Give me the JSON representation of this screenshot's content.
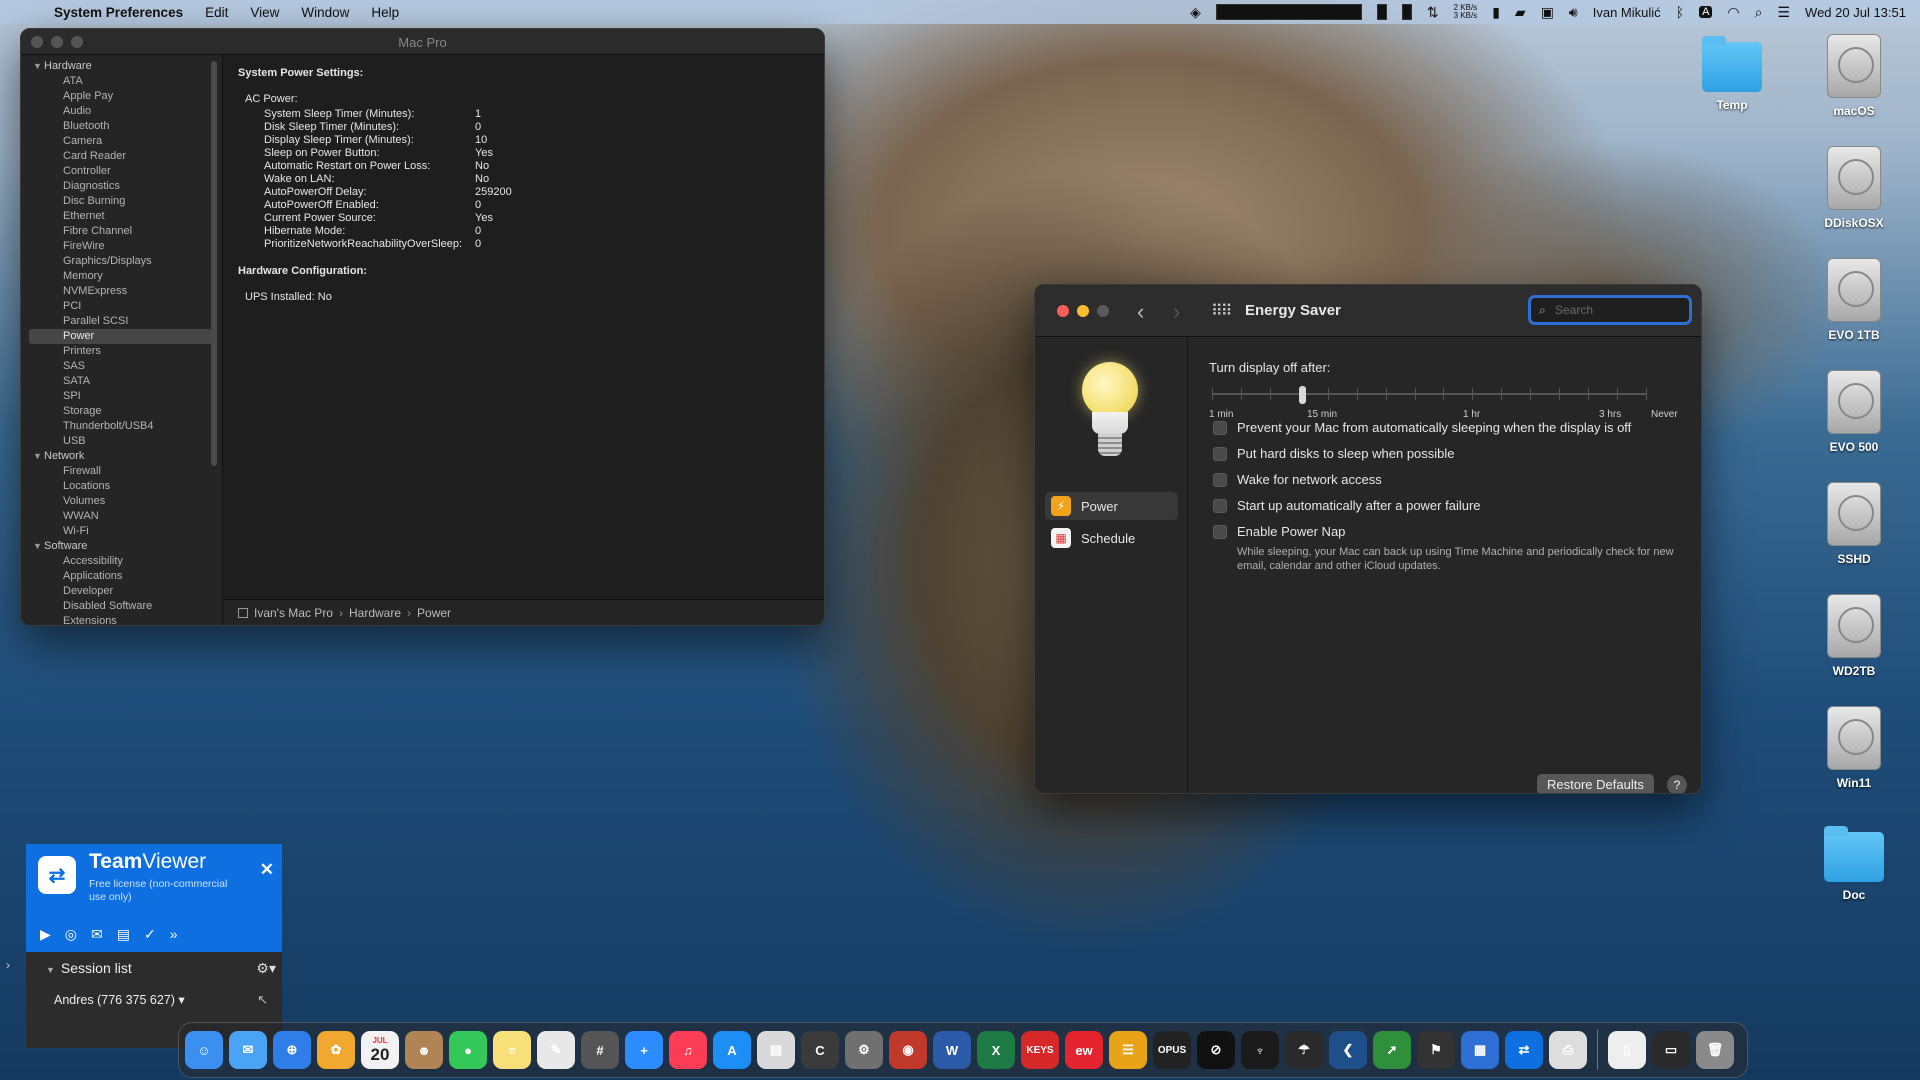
{
  "menubar": {
    "app_name": "System Preferences",
    "menus": [
      "Edit",
      "View",
      "Window",
      "Help"
    ],
    "net_up": "2 KB/s",
    "net_down": "3 KB/s",
    "user": "Ivan Mikulić",
    "datetime": "Wed 20 Jul  13:51"
  },
  "sysinfo": {
    "title": "Mac Pro",
    "sidebar": [
      {
        "type": "group",
        "label": "Hardware"
      },
      {
        "type": "item",
        "label": "ATA"
      },
      {
        "type": "item",
        "label": "Apple Pay"
      },
      {
        "type": "item",
        "label": "Audio"
      },
      {
        "type": "item",
        "label": "Bluetooth"
      },
      {
        "type": "item",
        "label": "Camera"
      },
      {
        "type": "item",
        "label": "Card Reader"
      },
      {
        "type": "item",
        "label": "Controller"
      },
      {
        "type": "item",
        "label": "Diagnostics"
      },
      {
        "type": "item",
        "label": "Disc Burning"
      },
      {
        "type": "item",
        "label": "Ethernet"
      },
      {
        "type": "item",
        "label": "Fibre Channel"
      },
      {
        "type": "item",
        "label": "FireWire"
      },
      {
        "type": "item",
        "label": "Graphics/Displays"
      },
      {
        "type": "item",
        "label": "Memory"
      },
      {
        "type": "item",
        "label": "NVMExpress"
      },
      {
        "type": "item",
        "label": "PCI"
      },
      {
        "type": "item",
        "label": "Parallel SCSI"
      },
      {
        "type": "item",
        "label": "Power",
        "selected": true
      },
      {
        "type": "item",
        "label": "Printers"
      },
      {
        "type": "item",
        "label": "SAS"
      },
      {
        "type": "item",
        "label": "SATA"
      },
      {
        "type": "item",
        "label": "SPI"
      },
      {
        "type": "item",
        "label": "Storage"
      },
      {
        "type": "item",
        "label": "Thunderbolt/USB4"
      },
      {
        "type": "item",
        "label": "USB"
      },
      {
        "type": "group",
        "label": "Network"
      },
      {
        "type": "item",
        "label": "Firewall"
      },
      {
        "type": "item",
        "label": "Locations"
      },
      {
        "type": "item",
        "label": "Volumes"
      },
      {
        "type": "item",
        "label": "WWAN"
      },
      {
        "type": "item",
        "label": "Wi-Fi"
      },
      {
        "type": "group",
        "label": "Software"
      },
      {
        "type": "item",
        "label": "Accessibility"
      },
      {
        "type": "item",
        "label": "Applications"
      },
      {
        "type": "item",
        "label": "Developer"
      },
      {
        "type": "item",
        "label": "Disabled Software"
      },
      {
        "type": "item",
        "label": "Extensions"
      }
    ],
    "content": {
      "heading": "System Power Settings:",
      "subheading": "AC Power:",
      "rows": [
        {
          "k": "System Sleep Timer (Minutes):",
          "v": "1"
        },
        {
          "k": "Disk Sleep Timer (Minutes):",
          "v": "0"
        },
        {
          "k": "Display Sleep Timer (Minutes):",
          "v": "10"
        },
        {
          "k": "Sleep on Power Button:",
          "v": "Yes"
        },
        {
          "k": "Automatic Restart on Power Loss:",
          "v": "No"
        },
        {
          "k": "Wake on LAN:",
          "v": "No"
        },
        {
          "k": "AutoPowerOff Delay:",
          "v": "259200"
        },
        {
          "k": "AutoPowerOff Enabled:",
          "v": "0"
        },
        {
          "k": "Current Power Source:",
          "v": "Yes"
        },
        {
          "k": "Hibernate Mode:",
          "v": "0"
        },
        {
          "k": "PrioritizeNetworkReachabilityOverSleep:",
          "v": "0"
        }
      ],
      "heading2": "Hardware Configuration:",
      "ups": "UPS Installed:  No"
    },
    "path": [
      "Ivan's Mac Pro",
      "Hardware",
      "Power"
    ]
  },
  "energy": {
    "title": "Energy Saver",
    "search_placeholder": "Search",
    "sidebar": [
      {
        "label": "Power",
        "icon": "lightning-icon",
        "selected": true
      },
      {
        "label": "Schedule",
        "icon": "calendar-icon",
        "selected": false
      }
    ],
    "slider_label": "Turn display off after:",
    "slider_value_fraction": 0.2,
    "slider_labels": [
      "1 min",
      "15 min",
      "1 hr",
      "3 hrs",
      "Never"
    ],
    "options": [
      {
        "label": "Prevent your Mac from automatically sleeping when the display is off",
        "checked": false
      },
      {
        "label": "Put hard disks to sleep when possible",
        "checked": false
      },
      {
        "label": "Wake for network access",
        "checked": false
      },
      {
        "label": "Start up automatically after a power failure",
        "checked": false
      },
      {
        "label": "Enable Power Nap",
        "checked": false
      }
    ],
    "power_nap_note": "While sleeping, your Mac can back up using Time Machine and periodically check for new email, calendar and other iCloud updates.",
    "restore_label": "Restore Defaults",
    "help_label": "?"
  },
  "desktop_icons": [
    {
      "label": "Temp",
      "kind": "folder"
    },
    {
      "label": "macOS",
      "kind": "disk"
    },
    {
      "label": "DDiskOSX",
      "kind": "disk"
    },
    {
      "label": "EVO 1TB",
      "kind": "disk"
    },
    {
      "label": "EVO 500",
      "kind": "disk"
    },
    {
      "label": "SSHD",
      "kind": "disk"
    },
    {
      "label": "WD2TB",
      "kind": "disk"
    },
    {
      "label": "Win11",
      "kind": "disk"
    },
    {
      "label": "Doc",
      "kind": "folder"
    }
  ],
  "teamviewer": {
    "brand_bold": "Team",
    "brand_rest": "Viewer",
    "license": "Free license (non-commercial use only)",
    "session_title": "Session list",
    "partner": "Andres (776 375 627)"
  },
  "dock": {
    "calendar_month": "JUL",
    "calendar_day": "20",
    "keys_label": "KEYS",
    "opus_label": "OPUS",
    "apps": [
      {
        "name": "finder-icon",
        "color": "#3b8ff0",
        "glyph": "☺"
      },
      {
        "name": "mail-icon",
        "color": "#4aa3f5",
        "glyph": "✉"
      },
      {
        "name": "safari-icon",
        "color": "#2f7de8",
        "glyph": "⊕"
      },
      {
        "name": "photos-icon",
        "color": "#f0a830",
        "glyph": "✿"
      },
      {
        "name": "calendar-icon",
        "color": "#f2f2f2",
        "glyph": ""
      },
      {
        "name": "contacts-icon",
        "color": "#b08455",
        "glyph": "☻"
      },
      {
        "name": "messages-icon",
        "color": "#34c759",
        "glyph": "●"
      },
      {
        "name": "notes-icon",
        "color": "#f7e07a",
        "glyph": "≡"
      },
      {
        "name": "textedit-icon",
        "color": "#e8e8e8",
        "glyph": "✎"
      },
      {
        "name": "calculator-icon",
        "color": "#555555",
        "glyph": "#"
      },
      {
        "name": "zoom-icon",
        "color": "#2d8cff",
        "glyph": "+"
      },
      {
        "name": "music-icon",
        "color": "#fa3c55",
        "glyph": "♫"
      },
      {
        "name": "appstore-icon",
        "color": "#1c8ef5",
        "glyph": "A"
      },
      {
        "name": "preview-icon",
        "color": "#d9d9d9",
        "glyph": "▤"
      },
      {
        "name": "ccleaner-icon",
        "color": "#3a3a3a",
        "glyph": "C"
      },
      {
        "name": "system-prefs-icon",
        "color": "#707070",
        "glyph": "⚙"
      },
      {
        "name": "photo-booth-icon",
        "color": "#c0392b",
        "glyph": "◉"
      },
      {
        "name": "word-icon",
        "color": "#2b5aa8",
        "glyph": "W"
      },
      {
        "name": "excel-icon",
        "color": "#1e7a44",
        "glyph": "X"
      },
      {
        "name": "keys-icon",
        "color": "#d62828",
        "glyph": ""
      },
      {
        "name": "scribe-icon",
        "color": "#e4242f",
        "glyph": "ew"
      },
      {
        "name": "menu-icon",
        "color": "#e8a317",
        "glyph": "☰"
      },
      {
        "name": "opus-icon",
        "color": "#222222",
        "glyph": ""
      },
      {
        "name": "capture-icon",
        "color": "#111111",
        "glyph": "⊘"
      },
      {
        "name": "tuner-icon",
        "color": "#1a1a1a",
        "glyph": "♆"
      },
      {
        "name": "dish-icon",
        "color": "#2a2a2a",
        "glyph": "☂"
      },
      {
        "name": "back-icon",
        "color": "#1f4f8a",
        "glyph": "❮"
      },
      {
        "name": "speedify-icon",
        "color": "#2f8f3a",
        "glyph": "➚"
      },
      {
        "name": "flag-icon",
        "color": "#333333",
        "glyph": "⚑"
      },
      {
        "name": "files-icon",
        "color": "#2e6fd6",
        "glyph": "▦"
      },
      {
        "name": "teamviewer-icon",
        "color": "#0e6fe0",
        "glyph": "⇄"
      },
      {
        "name": "printer-icon",
        "color": "#dddddd",
        "glyph": "⎙"
      }
    ],
    "trailing": [
      {
        "name": "document-icon",
        "color": "#eeeeee",
        "glyph": "▯"
      },
      {
        "name": "screen-icon",
        "color": "#2a2a2a",
        "glyph": "▭"
      },
      {
        "name": "trash-icon",
        "color": "#8a8a8a",
        "glyph": "🗑"
      }
    ]
  }
}
